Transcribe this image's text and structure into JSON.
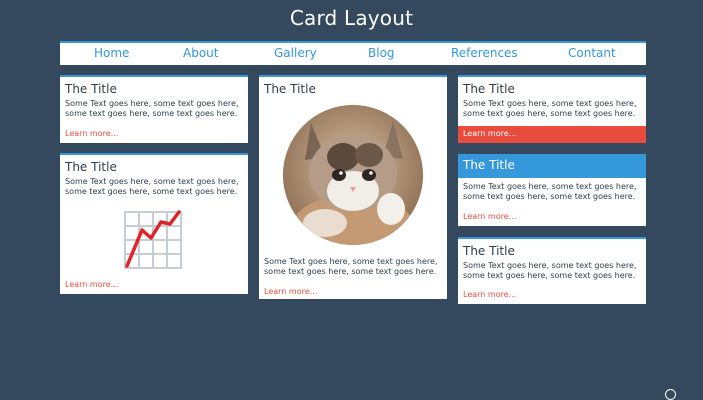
{
  "header": {
    "title": "Card Layout"
  },
  "nav": {
    "items": [
      {
        "label": "Home"
      },
      {
        "label": "About"
      },
      {
        "label": "Gallery"
      },
      {
        "label": "Blog"
      },
      {
        "label": "References"
      },
      {
        "label": "Contant"
      }
    ]
  },
  "cards": {
    "c1": {
      "title": "The Title",
      "text": "Some Text goes here, some text goes here, some text goes here, some text goes here.",
      "link": "Learn more..."
    },
    "c2": {
      "title": "The Title",
      "text": "Some Text goes here, some text goes here, some text goes here, some text goes here.",
      "link": "Learn more...",
      "icon": "chart-increasing-icon"
    },
    "c3": {
      "title": "The Title",
      "text": "Some Text goes here, some text goes here, some text goes here, some text goes here.",
      "link": "Learn more...",
      "image": "kitten-photo"
    },
    "c4": {
      "title": "The Title",
      "text": "Some Text goes here, some text goes here, some text goes here, some text goes here.",
      "link": "Learn more..."
    },
    "c5": {
      "title": "The Title",
      "text": "Some Text goes here, some text goes here, some text goes here, some text goes here.",
      "link": "Learn more..."
    },
    "c6": {
      "title": "The Title",
      "text": "Some Text goes here, some text goes here, some text goes here, some text goes here.",
      "link": "Learn more..."
    }
  },
  "colors": {
    "background": "#34495e",
    "accent": "#3498db",
    "link": "#e74c3c",
    "card": "#ffffff"
  }
}
